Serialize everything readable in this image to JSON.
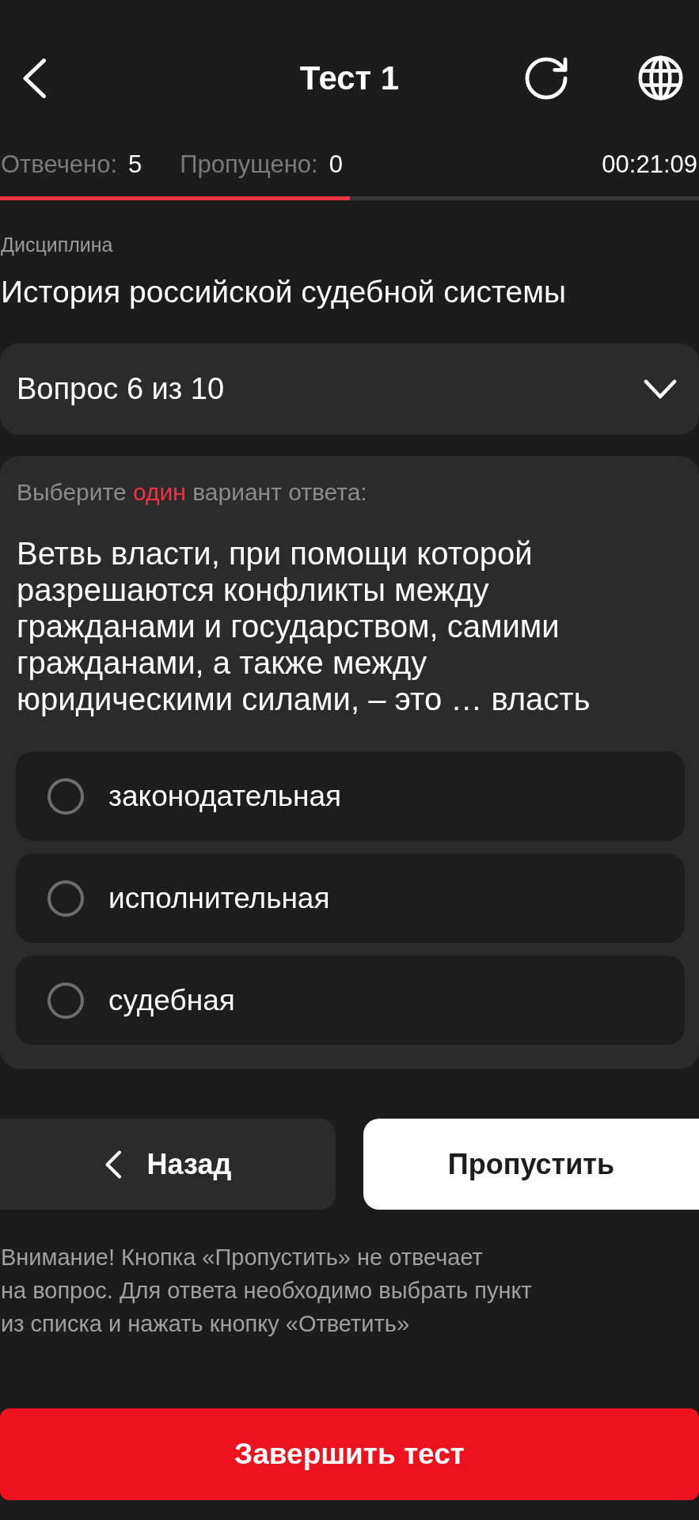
{
  "header": {
    "title": "Тест 1"
  },
  "stats": [
    {
      "label": "Отвечено:",
      "value": "5"
    },
    {
      "label": "Пропущено:",
      "value": "0"
    }
  ],
  "timer": "00:21:09",
  "progress": {
    "level": 0.5
  },
  "discipline": {
    "label": "Дисциплина",
    "value": "История российской судебной системы"
  },
  "question_selector": {
    "label": "Вопрос 6 из 10",
    "expanded": false
  },
  "question": {
    "instruction": "Выберите **один** вариант ответа:",
    "text": "Ветвь власти, при помощи которой разрешаются конфликты между гражданами и государством, самими гражданами, а также между юридическими силами, – это … власть",
    "options": [
      {
        "label": "законодательная",
        "selected": false
      },
      {
        "label": "исполнительная",
        "selected": false
      },
      {
        "label": "судебная",
        "selected": false
      }
    ]
  },
  "nav": {
    "back": "Назад",
    "skip": "Пропустить"
  },
  "notice": "Внимание! Кнопка «Пропустить» не отвечает на вопрос. Для ответа необходимо выбрать пункт из списка и нажать кнопку «Ответить»",
  "finish_button": "Завершить тест"
}
